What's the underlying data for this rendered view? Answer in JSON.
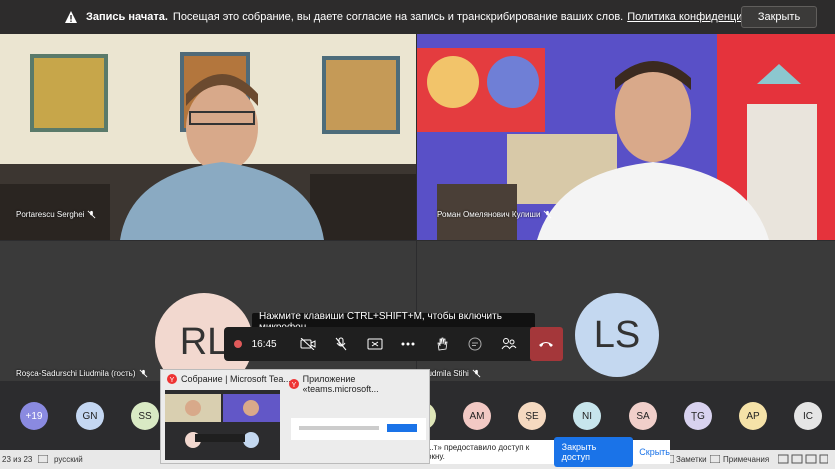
{
  "banner": {
    "bold": "Запись начата.",
    "text": "Посещая это собрание, вы даете согласие на запись и транскрибирование ваших слов.",
    "link": "Политика конфиденциальности",
    "close_label": "Закрыть"
  },
  "participants": [
    {
      "name": "Portarescu Serghei"
    },
    {
      "name": "Роман Омелянович Кулиши"
    },
    {
      "name": "Roșca-Sadurschi Liudmila (гость)",
      "initials": "RL"
    },
    {
      "name": "Ludmila Stihi",
      "initials": "LS"
    }
  ],
  "controls": {
    "timer": "16:45",
    "tooltip": "Нажмите клавиши CTRL+SHIFT+M, чтобы включить микрофон."
  },
  "chips": [
    {
      "label": "+19",
      "color": "#8a8ae0"
    },
    {
      "label": "GN",
      "color": "#c4d7f2"
    },
    {
      "label": "SS",
      "color": "#d9eac4"
    },
    {
      "label": "M",
      "color": "#dfe6b8"
    },
    {
      "label": "AM",
      "color": "#f2c9c4"
    },
    {
      "label": "ȘE",
      "color": "#f5d9c0"
    },
    {
      "label": "NI",
      "color": "#c7e5ec"
    },
    {
      "label": "SA",
      "color": "#f0cfca"
    },
    {
      "label": "ȚG",
      "color": "#d8d2ef"
    },
    {
      "label": "AP",
      "color": "#f5e2a8"
    },
    {
      "label": "IC",
      "color": "#e5e5e5"
    }
  ],
  "taskbar": {
    "left_count": "23 из 23",
    "language": "русский",
    "notes": "Заметки",
    "comments": "Примечания"
  },
  "popup": {
    "thumb1_title": "Собрание | Microsoft Tea...",
    "thumb2_title": "Приложение «teams.microsoft..."
  },
  "sharebar": {
    "text": "...т» предоставило доступ к окну.",
    "share_label": "Закрыть доступ",
    "hide_label": "Скрыть"
  }
}
